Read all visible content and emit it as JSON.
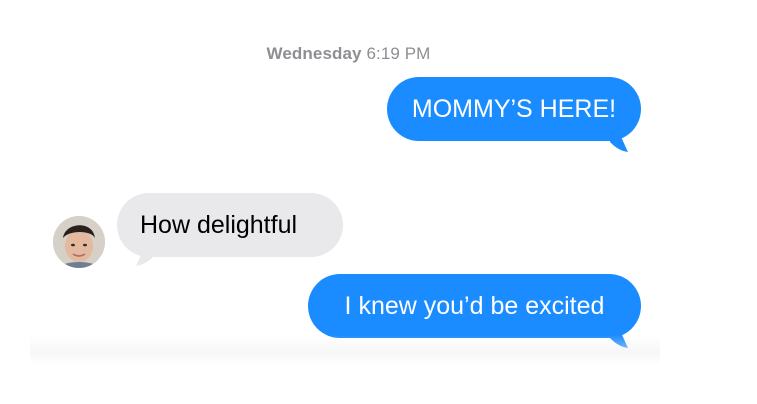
{
  "conversation": {
    "timestamp": {
      "day": "Wednesday",
      "time": "6:19 PM"
    },
    "messages": [
      {
        "text": "MOMMY’S HERE!",
        "direction": "sent"
      },
      {
        "text": "How delightful",
        "direction": "received"
      },
      {
        "text": "I knew you’d be excited",
        "direction": "sent"
      }
    ]
  },
  "colors": {
    "sent_bubble": "#1a8cff",
    "received_bubble": "#e9e9eb",
    "timestamp": "#8e8e93"
  },
  "icons": {
    "contact_avatar": "person-avatar"
  }
}
